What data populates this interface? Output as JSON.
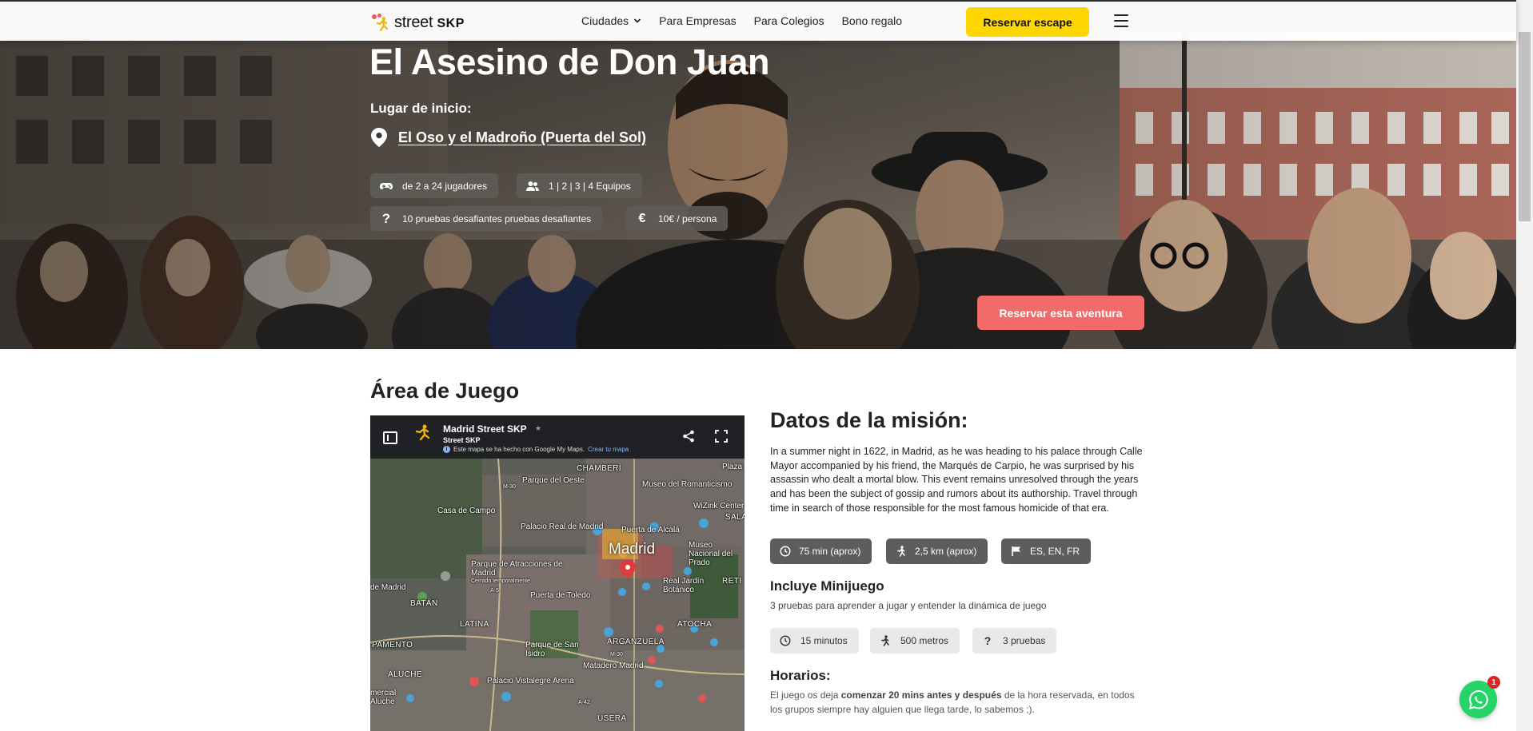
{
  "colors": {
    "brand_yellow": "#ffd600",
    "cta_coral": "#f26a6a",
    "badge_dark": "#5d5d5d",
    "badge_light": "#e9e9e9",
    "whatsapp_green": "#25d366"
  },
  "nav": {
    "logo_text": "street",
    "logo_bold": "SKP",
    "links": [
      {
        "label": "Ciudades",
        "icon": "chevron-down-icon"
      },
      {
        "label": "Para Empresas"
      },
      {
        "label": "Para Colegios"
      },
      {
        "label": "Bono regalo"
      }
    ],
    "reserve_label": "Reservar escape",
    "menu_icon": "hamburger-icon"
  },
  "hero": {
    "title": "El Asesino de Don Juan",
    "start_label": "Lugar de inicio:",
    "start_location": "El Oso y el Madroño (Puerta del Sol)",
    "chips": [
      {
        "icon": "gamepad-icon",
        "label": "de 2 a 24 jugadores"
      },
      {
        "icon": "users-icon",
        "label": "1 | 2 | 3 | 4 Equipos"
      },
      {
        "icon": "question-icon",
        "glyph": "?",
        "label": "10 pruebas desafiantes pruebas desafiantes"
      },
      {
        "icon": "euro-icon",
        "glyph": "€",
        "label": "10€ / persona"
      }
    ],
    "cta_label": "Reservar esta aventura"
  },
  "area": {
    "title": "Área de Juego",
    "map": {
      "title": "Madrid Street SKP",
      "owner": "Street SKP",
      "note": "Este mapa se ha hecho con Google My Maps.",
      "note_link": "Crear tu mapa",
      "labels": {
        "chamberi": "CHAMBERÍ",
        "museo_romanticismo": "Museo del Romanticismo",
        "plaza": "Plaza",
        "parque_oeste": "Parque del Oeste",
        "m30": "M-30",
        "casa_campo": "Casa de Campo",
        "palacio_real": "Palacio Real de Madrid",
        "puerta_alcala": "Puerta de Alcalá",
        "wizink": "WiZink Center",
        "sala": "SALA",
        "madrid": "Madrid",
        "museo_prado": "Museo Nacional del Prado",
        "parque_atracciones": "Parque de Atracciones de Madrid",
        "cerrado": "Cerrado temporalmente",
        "de_madrid": "de Madrid",
        "a5": "A-5",
        "puerta_toledo": "Puerta de Toledo",
        "real_jardin": "Real Jardín Botánico",
        "retiro": "RETI",
        "batan": "BATÁN",
        "latina": "LATINA",
        "atocha": "ATOCHA",
        "pamento": "PAMENTO",
        "parque_sanisidro": "Parque de San Isidro",
        "arganzuela": "ARGANZUELA",
        "m30b": "M-30",
        "matadero": "Matadero Madrid",
        "aluche": "ALUCHE",
        "palacio_vistalegre": "Palacio Vistalegre Arena",
        "mercial_aluche": "mercial Aluche",
        "a42": "A-42",
        "usera": "USERA"
      }
    }
  },
  "mission": {
    "title": "Datos de la misión:",
    "description": "In a summer night in 1622, in Madrid, as he was heading to his palace through Calle Mayor accompanied by his friend, the Marqués de Carpio, he was surprised by his assassin who dealt a mortal blow. This event remains unresolved through the years and has been the subject of gossip and rumors about its authorship. Travel through time in search of those responsible for the most famous homicide of that era.",
    "badges": [
      {
        "icon": "clock-icon",
        "label": "75 min (aprox)"
      },
      {
        "icon": "walking-icon",
        "label": "2,5 km (aprox)"
      },
      {
        "icon": "flag-icon",
        "label": "ES, EN, FR"
      }
    ],
    "minigame_title": "Incluye Minijuego",
    "minigame_desc": "3 pruebas para aprender a jugar y entender la dinámica de juego",
    "minigame_chips": [
      {
        "icon": "clock-icon",
        "label": "15 minutos"
      },
      {
        "icon": "walking-icon",
        "label": "500 metros"
      },
      {
        "icon": "question-icon",
        "glyph": "?",
        "label": "3 pruebas"
      }
    ],
    "hours_title": "Horarios:",
    "hours_part1": "El juego os deja ",
    "hours_bold": "comenzar 20 mins antes y después",
    "hours_part2": " de la hora reservada, en todos los grupos siempre hay alguien que llega tarde, lo sabemos ;)."
  },
  "whatsapp": {
    "badge_count": "1"
  }
}
